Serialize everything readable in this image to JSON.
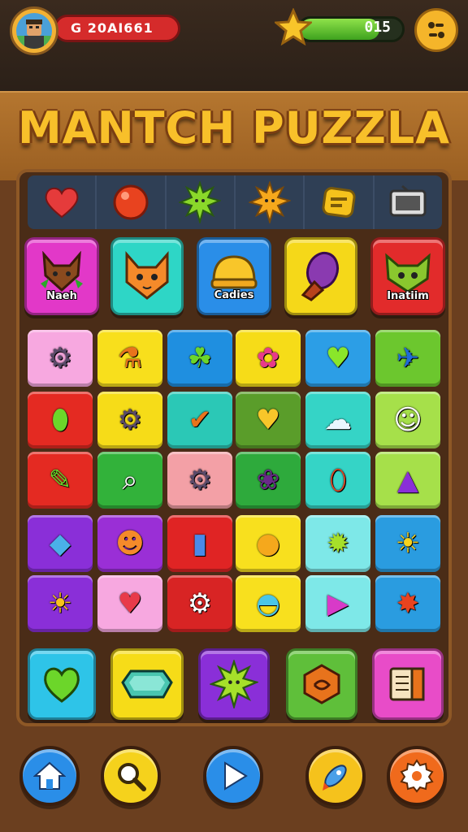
{
  "header": {
    "player_name": "G 20AI661",
    "progress_value": "015",
    "progress_fraction": 0.78
  },
  "title": "MANTCH PUZZLA",
  "top_row": {
    "items": [
      {
        "icon": "heart-icon"
      },
      {
        "icon": "red-ball-icon"
      },
      {
        "icon": "green-sun-icon"
      },
      {
        "icon": "sun-face-icon"
      },
      {
        "icon": "yellow-badge-icon"
      },
      {
        "icon": "tv-icon"
      }
    ]
  },
  "cards": [
    {
      "label": "Naeh",
      "icon": "brown-fox-icon",
      "color": "#e238c8"
    },
    {
      "label": "",
      "icon": "orange-cat-icon",
      "color": "#2ed6c6"
    },
    {
      "label": "Cadies",
      "icon": "yellow-helmet-icon",
      "color": "#2a8ee8"
    },
    {
      "label": "",
      "icon": "purple-gem-icon",
      "color": "#f5d819"
    },
    {
      "label": "Inatiim",
      "icon": "green-monster-icon",
      "color": "#e22b2b"
    }
  ],
  "grid": [
    [
      {
        "icon": "pink-robot-icon",
        "color": "#f7a8e0"
      },
      {
        "icon": "vase-icon",
        "color": "#f8df1c"
      },
      {
        "icon": "green-leaf-icon",
        "color": "#1f8fe0"
      },
      {
        "icon": "pink-blob-icon",
        "color": "#f6dc18"
      },
      {
        "icon": "green-heart-icon",
        "color": "#2c9ee6"
      },
      {
        "icon": "blue-plane-icon",
        "color": "#6cc72e"
      }
    ],
    [
      {
        "icon": "green-lemon-icon",
        "color": "#e42a22"
      },
      {
        "icon": "pink-robot-icon",
        "color": "#f6dc18"
      },
      {
        "icon": "orange-stick-icon",
        "color": "#2bc8b6"
      },
      {
        "icon": "yellow-heart-icon",
        "color": "#5a9d2a"
      },
      {
        "icon": "cloud-icon",
        "color": "#35d4c6"
      },
      {
        "icon": "ghost-icon",
        "color": "#a6e04a"
      }
    ],
    [
      {
        "icon": "pen-icon",
        "color": "#e42a22"
      },
      {
        "icon": "magnifier-icon",
        "color": "#32b23a"
      },
      {
        "icon": "pink-robot-icon",
        "color": "#f3a0a6"
      },
      {
        "icon": "purple-bug-icon",
        "color": "#2eaa3c"
      },
      {
        "icon": "capsule-icon",
        "color": "#35d4c6"
      },
      {
        "icon": "purple-drop-icon",
        "color": "#a6e04a"
      }
    ],
    [
      {
        "icon": "blue-crystal-icon",
        "color": "#8a2fd8"
      },
      {
        "icon": "orange-fox-icon",
        "color": "#9a2fd6"
      },
      {
        "icon": "blue-bottle-icon",
        "color": "#e02424"
      },
      {
        "icon": "lollipop-icon",
        "color": "#f8e01e"
      },
      {
        "icon": "green-sun-icon",
        "color": "#7ee8e8"
      },
      {
        "icon": "sun-face-icon",
        "color": "#2a9ce0"
      }
    ],
    [
      {
        "icon": "sun-icon",
        "color": "#8a2fd8"
      },
      {
        "icon": "red-heart-icon",
        "color": "#f7a8e0"
      },
      {
        "icon": "gear-flower-icon",
        "color": "#d82424"
      },
      {
        "icon": "blue-dome-icon",
        "color": "#f8e01e"
      },
      {
        "icon": "play-arrow-icon",
        "color": "#7ee8e8"
      },
      {
        "icon": "red-bird-icon",
        "color": "#2a9ce0"
      }
    ]
  ],
  "bottom_row": [
    {
      "icon": "green-heart-icon",
      "color": "#2ec4e8"
    },
    {
      "icon": "teal-gem-icon",
      "color": "#f6dc18"
    },
    {
      "icon": "green-sun-icon",
      "color": "#8a2fd8"
    },
    {
      "icon": "orange-emblem-icon",
      "color": "#5fbf3a"
    },
    {
      "icon": "book-icon",
      "color": "#e84cc8"
    }
  ],
  "nav": [
    {
      "icon": "home-icon",
      "color": "#2a8ee8"
    },
    {
      "icon": "search-icon",
      "color": "#f5d21c"
    },
    {
      "icon": "play-icon",
      "color": "#2a8ee8"
    },
    {
      "icon": "rocket-icon",
      "color": "#f5c21c"
    },
    {
      "icon": "gear-icon",
      "color": "#f06a1c"
    }
  ]
}
